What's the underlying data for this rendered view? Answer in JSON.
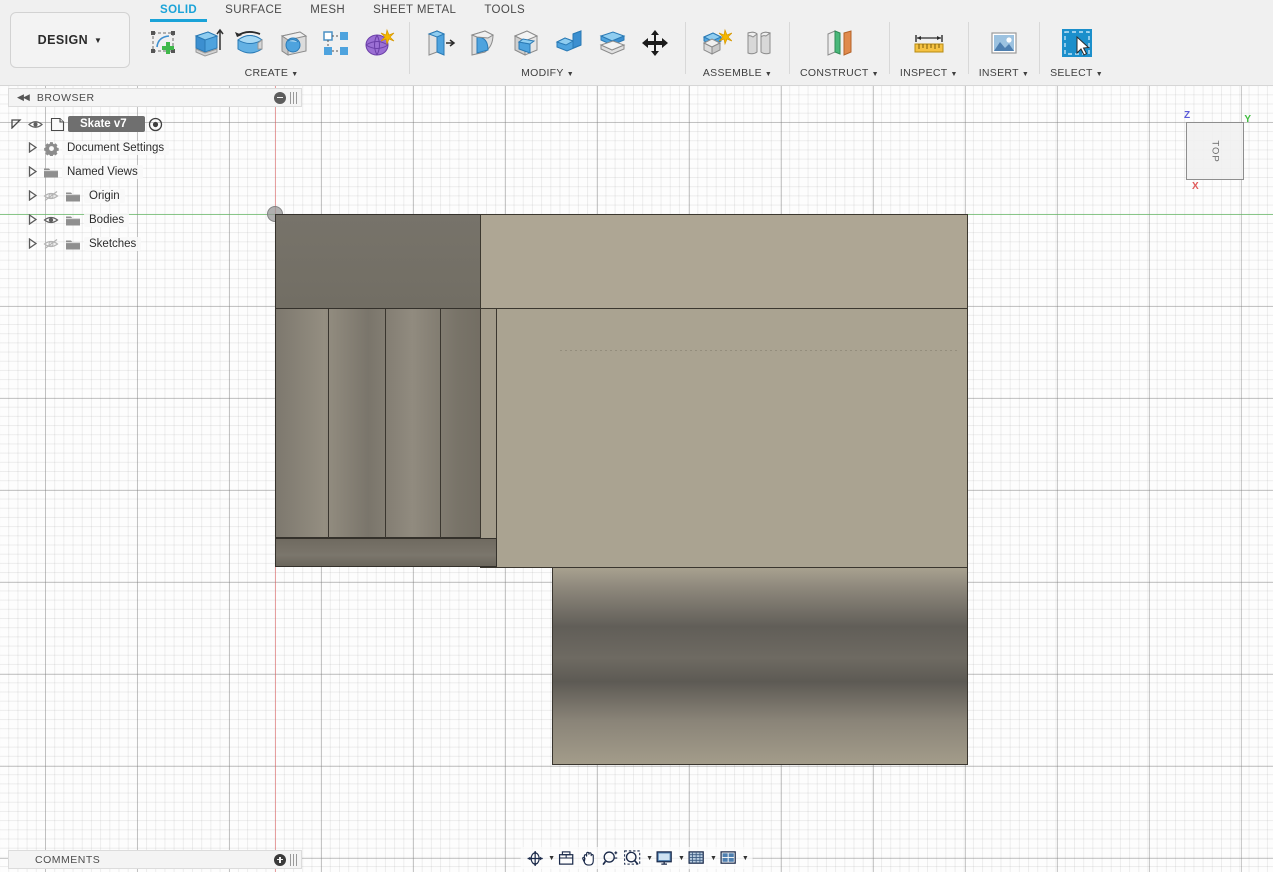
{
  "app": {
    "workspace_label": "DESIGN",
    "document_name": "Skate v7"
  },
  "tabs": [
    {
      "label": "SOLID",
      "active": true
    },
    {
      "label": "SURFACE",
      "active": false
    },
    {
      "label": "MESH",
      "active": false
    },
    {
      "label": "SHEET METAL",
      "active": false
    },
    {
      "label": "TOOLS",
      "active": false
    }
  ],
  "ribbon": {
    "groups": [
      {
        "label": "CREATE",
        "name": "create",
        "icons": [
          "new-sketch-icon",
          "extrude-icon",
          "revolve-icon",
          "sweep-icon",
          "pattern-icon",
          "form-icon"
        ]
      },
      {
        "label": "MODIFY",
        "name": "modify",
        "icons": [
          "press-pull-icon",
          "fillet-icon",
          "shell-icon",
          "combine-icon",
          "split-body-icon",
          "move-copy-icon"
        ]
      },
      {
        "label": "ASSEMBLE",
        "name": "assemble",
        "icons": [
          "new-component-icon",
          "joint-icon"
        ]
      },
      {
        "label": "CONSTRUCT",
        "name": "construct",
        "icons": [
          "offset-plane-icon"
        ]
      },
      {
        "label": "INSPECT",
        "name": "inspect",
        "icons": [
          "measure-icon"
        ]
      },
      {
        "label": "INSERT",
        "name": "insert",
        "icons": [
          "insert-image-icon"
        ]
      },
      {
        "label": "SELECT",
        "name": "select",
        "icons": [
          "select-cursor-icon"
        ]
      }
    ],
    "dropdown_caret": "▼"
  },
  "browser": {
    "title": "BROWSER",
    "collapse_icon": "◀◀",
    "minimize_icon": "minus-circle-icon",
    "tree": [
      {
        "label": "Skate v7",
        "level": 0,
        "root": true,
        "expanded": true,
        "icon": "document-icon",
        "visible": true,
        "has_target": true
      },
      {
        "label": "Document Settings",
        "level": 1,
        "expanded": false,
        "icon": "gear-icon",
        "eye": "none"
      },
      {
        "label": "Named Views",
        "level": 1,
        "expanded": false,
        "icon": "folder-icon",
        "eye": "none"
      },
      {
        "label": "Origin",
        "level": 1,
        "expanded": false,
        "icon": "folder-icon",
        "eye": "hidden"
      },
      {
        "label": "Bodies",
        "level": 1,
        "expanded": false,
        "icon": "folder-icon",
        "eye": "visible"
      },
      {
        "label": "Sketches",
        "level": 1,
        "expanded": false,
        "icon": "folder-icon",
        "eye": "hidden"
      }
    ]
  },
  "viewcube": {
    "face_label": "TOP",
    "axis_z": "Z",
    "axis_y": "Y",
    "axis_x": "X",
    "axis_z_color": "#5a5ad8",
    "axis_y_color": "#3fbd3f",
    "axis_x_color": "#e05a5a"
  },
  "comments": {
    "title": "COMMENTS",
    "add_icon": "plus-circle-icon"
  },
  "navbar": {
    "buttons": [
      {
        "name": "orbit-icon",
        "caret": true
      },
      {
        "name": "look-at-icon",
        "caret": false
      },
      {
        "name": "pan-hand-icon",
        "caret": false
      },
      {
        "name": "zoom-icon",
        "caret": false
      },
      {
        "name": "zoom-window-icon",
        "caret": true
      },
      {
        "name": "display-settings-icon",
        "caret": true
      },
      {
        "name": "grid-snaps-icon",
        "caret": true
      },
      {
        "name": "viewports-icon",
        "caret": true
      }
    ]
  },
  "viewport": {
    "origin_marker": "origin-point",
    "x_axis_color": "#dc5a5a",
    "y_axis_color": "#5ac85a",
    "model_name": "skate-deck-body",
    "material_light": "#aaa391",
    "material_dark": "#726e64"
  }
}
